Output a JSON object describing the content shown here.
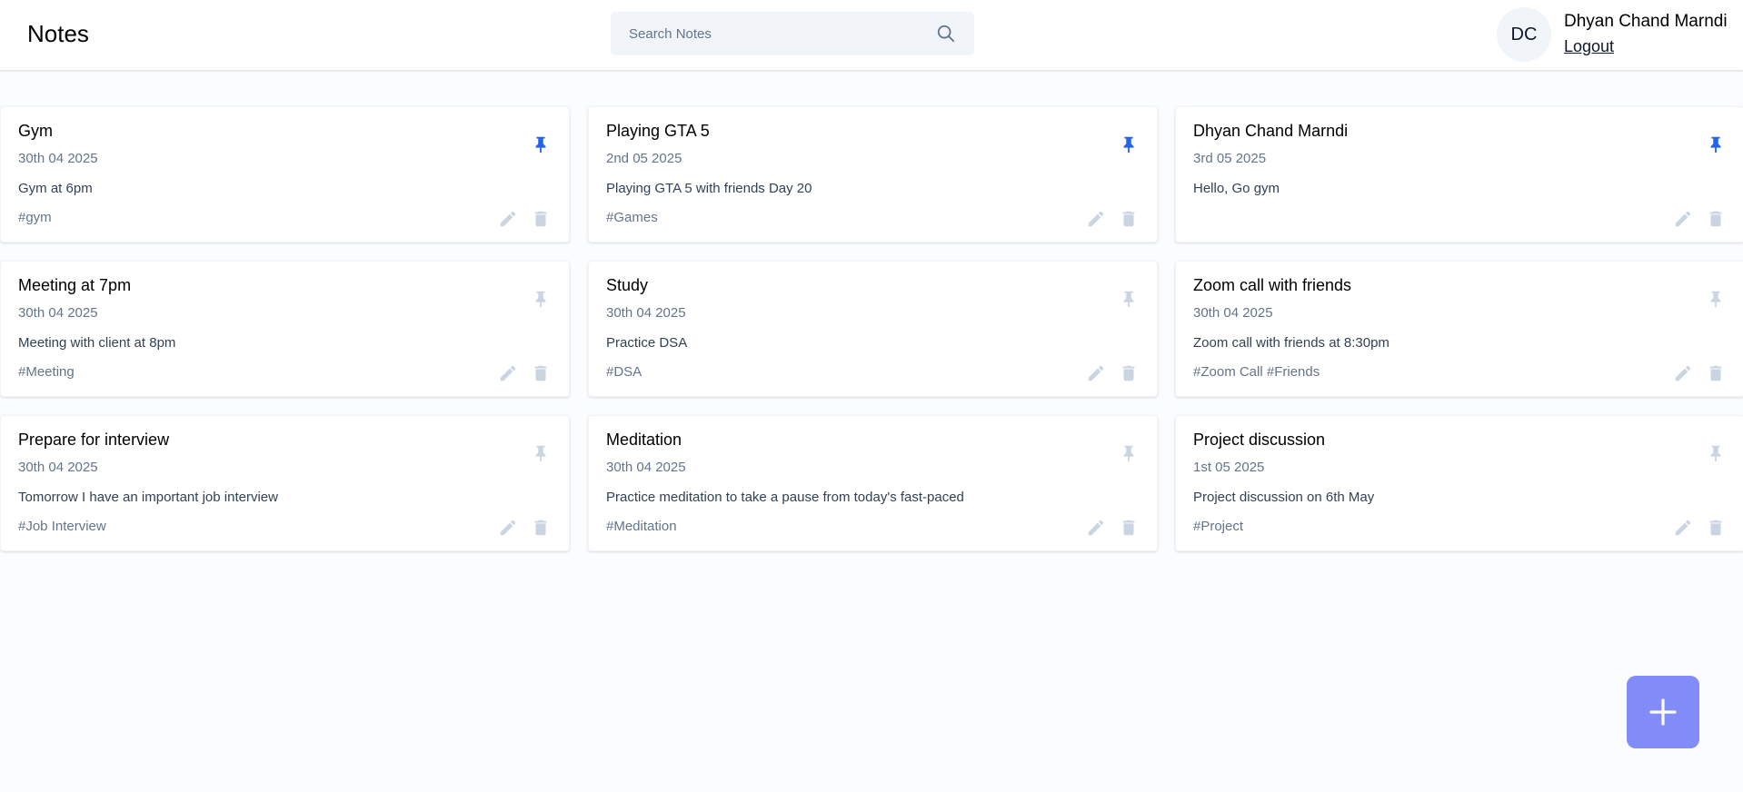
{
  "app": {
    "title": "Notes"
  },
  "search": {
    "placeholder": "Search Notes",
    "value": ""
  },
  "user": {
    "initials": "DC",
    "name": "Dhyan Chand Marndi",
    "logout_label": "Logout"
  },
  "colors": {
    "pinned": "#2563eb",
    "unpinned": "#cbd5e1",
    "action_icon": "#cbd5e1",
    "fab": "#818cf8"
  },
  "icons": {
    "search": "search-icon",
    "pin": "pin-icon",
    "edit": "pencil-icon",
    "delete": "trash-icon",
    "add": "plus-icon"
  },
  "notes": [
    {
      "title": "Gym",
      "date": "30th 04 2025",
      "content": "Gym at 6pm",
      "tags": "#gym",
      "pinned": true
    },
    {
      "title": "Playing GTA 5",
      "date": "2nd 05 2025",
      "content": "Playing GTA 5 with friends Day 20",
      "tags": "#Games",
      "pinned": true
    },
    {
      "title": "Dhyan Chand Marndi",
      "date": "3rd 05 2025",
      "content": "Hello, Go gym",
      "tags": "",
      "pinned": true
    },
    {
      "title": "Meeting at 7pm",
      "date": "30th 04 2025",
      "content": "Meeting with client at 8pm",
      "tags": "#Meeting",
      "pinned": false
    },
    {
      "title": "Study",
      "date": "30th 04 2025",
      "content": "Practice DSA",
      "tags": "#DSA",
      "pinned": false
    },
    {
      "title": "Zoom call with friends",
      "date": "30th 04 2025",
      "content": "Zoom call with friends at 8:30pm",
      "tags": "#Zoom Call #Friends",
      "pinned": false
    },
    {
      "title": "Prepare for interview",
      "date": "30th 04 2025",
      "content": "Tomorrow I have an important job interview",
      "tags": "#Job Interview",
      "pinned": false
    },
    {
      "title": "Meditation",
      "date": "30th 04 2025",
      "content": "Practice meditation to take a pause from today's fast-paced",
      "tags": "#Meditation",
      "pinned": false
    },
    {
      "title": "Project discussion",
      "date": "1st 05 2025",
      "content": "Project discussion on 6th May",
      "tags": "#Project",
      "pinned": false
    }
  ]
}
